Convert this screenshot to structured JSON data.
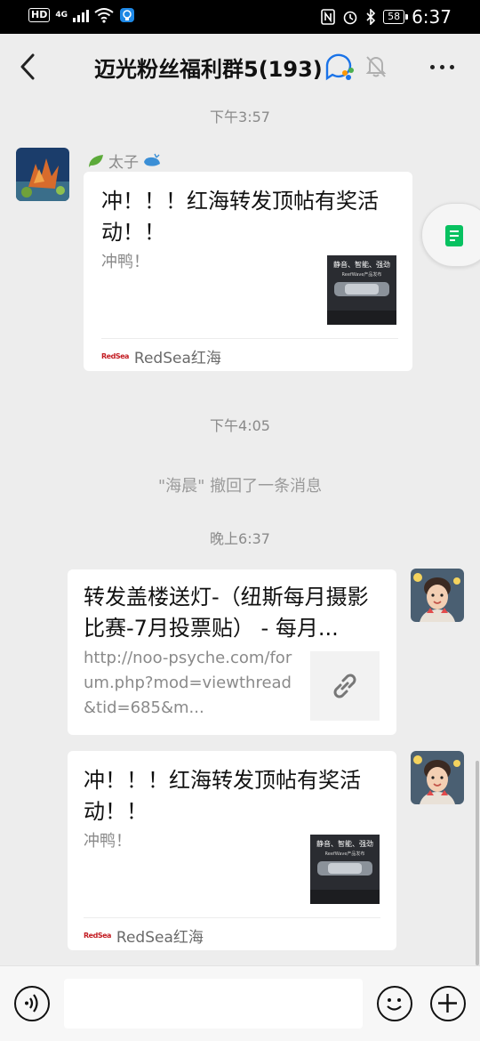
{
  "status_bar": {
    "hd_label": "HD",
    "signal_label": "4G",
    "battery": "58",
    "time": "6:37"
  },
  "header": {
    "title": "迈光粉丝福利群5(193)"
  },
  "messages": {
    "ts1": "下午3:57",
    "msg1": {
      "sender": "太子",
      "title": "冲！！！红海转发顶帖有奖活动！！",
      "desc": "冲鸭！",
      "thumb_text": "静音、智能、强劲",
      "thumb_sub": "ReefWave产品发布",
      "source_logo": "RedSea",
      "source": "RedSea红海"
    },
    "ts2": "下午4:05",
    "recall": "\"海晨\" 撤回了一条消息",
    "ts3": "晚上6:37",
    "msg2": {
      "title": "转发盖楼送灯-（纽斯每月摄影比赛-7月投票贴） - 每月...",
      "desc": "http://noo-psyche.com/forum.php?mod=viewthread&tid=685&m..."
    },
    "msg3": {
      "title": "冲！！！红海转发顶帖有奖活动！！",
      "desc": "冲鸭！",
      "thumb_text": "静音、智能、强劲",
      "thumb_sub": "ReefWave产品发布",
      "source_logo": "RedSea",
      "source": "RedSea红海"
    }
  },
  "icons": {
    "back": "chevron-left-icon",
    "group": "group-chat-icon",
    "mute": "bell-muted-icon",
    "more": "more-dots-icon",
    "doc": "document-icon",
    "link": "link-icon",
    "voice": "voice-icon",
    "emoji": "emoji-icon",
    "plus": "plus-icon"
  },
  "colors": {
    "background": "#ededed",
    "accent_green": "#07c160",
    "brand_red": "#c31d23"
  }
}
